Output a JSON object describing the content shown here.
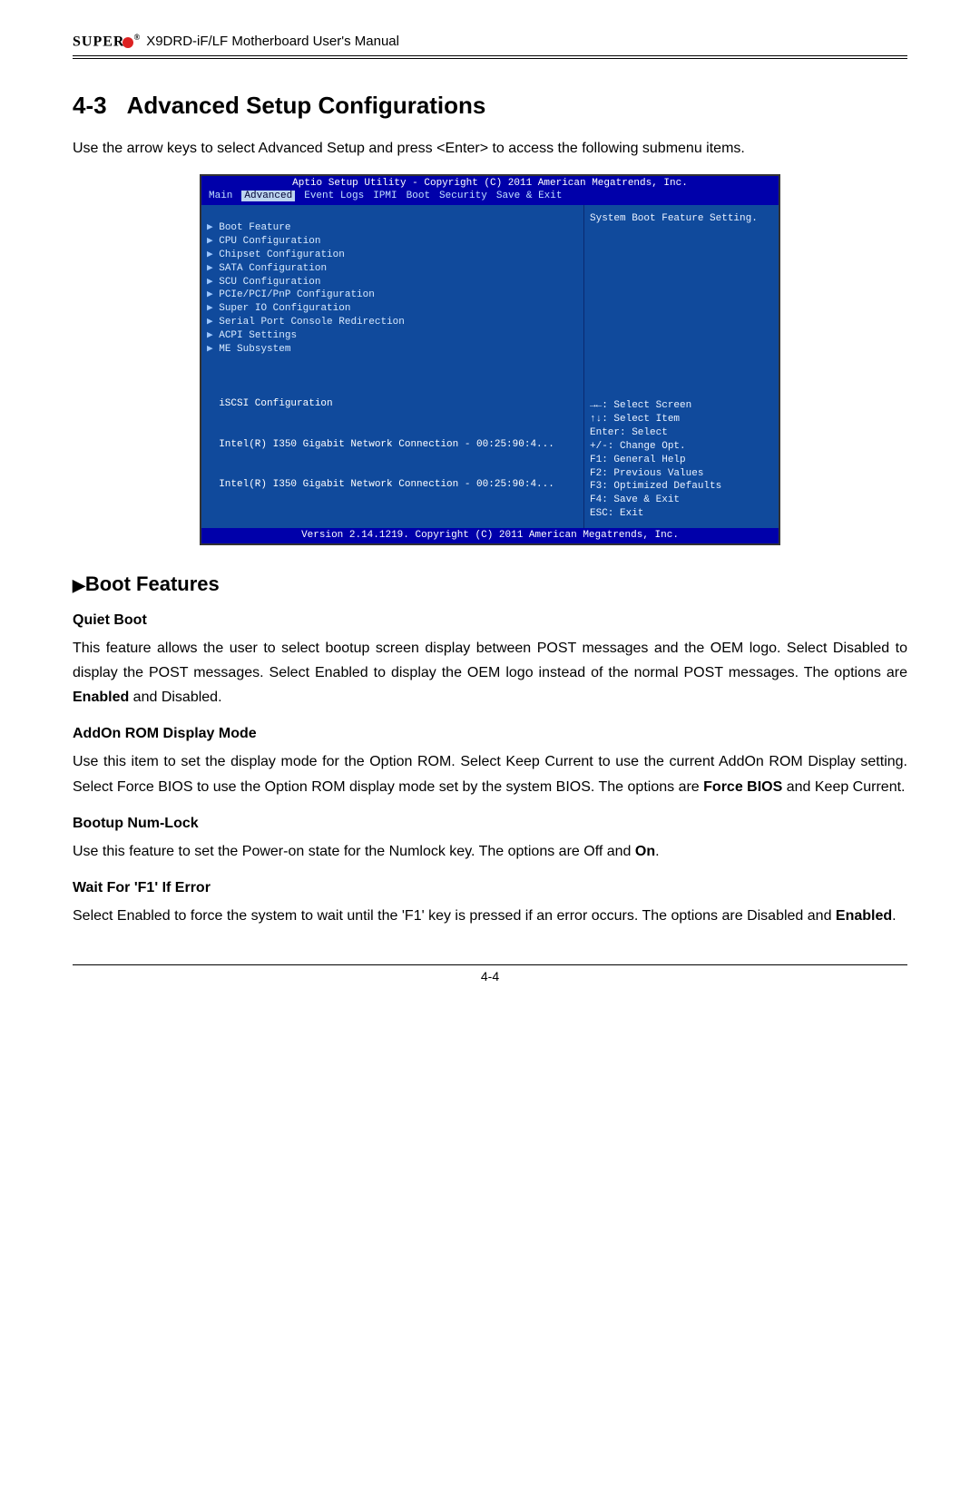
{
  "header": {
    "brand": "SUPER",
    "regmark": "®",
    "title": "X9DRD-iF/LF Motherboard User's Manual"
  },
  "section": {
    "number": "4-3",
    "title": "Advanced Setup Configurations",
    "intro": "Use the arrow keys to select Advanced Setup and press <Enter> to access the following submenu items."
  },
  "bios": {
    "title": "Aptio Setup Utility - Copyright (C) 2011 American Megatrends, Inc.",
    "menu": [
      "Main",
      "Advanced",
      "Event Logs",
      "IPMI",
      "Boot",
      "Security",
      "Save & Exit"
    ],
    "selected_tab": "Advanced",
    "items": [
      "Boot Feature",
      "CPU Configuration",
      "Chipset Configuration",
      "SATA Configuration",
      "SCU Configuration",
      "PCIe/PCI/PnP Configuration",
      "Super IO Configuration",
      "Serial Port Console Redirection",
      "ACPI Settings",
      "ME Subsystem"
    ],
    "secondary": [
      "iSCSI Configuration",
      "Intel(R) I350 Gigabit Network Connection - 00:25:90:4...",
      "Intel(R) I350 Gigabit Network Connection - 00:25:90:4..."
    ],
    "right_help": "System Boot Feature Setting.",
    "right_keys": "→←: Select Screen\n↑↓: Select Item\nEnter: Select\n+/-: Change Opt.\nF1: General Help\nF2: Previous Values\nF3: Optimized Defaults\nF4: Save & Exit\nESC: Exit",
    "footer": "Version 2.14.1219. Copyright (C) 2011 American Megatrends, Inc."
  },
  "subsection": {
    "title": "Boot Features"
  },
  "features": {
    "f1": {
      "h": "Quiet Boot",
      "p_a": "This feature allows the user to select bootup screen display between POST messages and the OEM logo. Select Disabled to display the POST messages. Select Enabled to display the OEM logo instead of the normal POST messages. The options are ",
      "p_b": "Enabled",
      "p_c": " and Disabled."
    },
    "f2": {
      "h": "AddOn ROM Display Mode",
      "p_a": "Use this item to set the display mode for the Option ROM. Select Keep Current to use the current AddOn ROM Display setting. Select Force BIOS to use the Option ROM display mode set by the system BIOS. The options are ",
      "p_b": "Force BIOS",
      "p_c": " and Keep Current."
    },
    "f3": {
      "h": "Bootup Num-Lock",
      "p_a": "Use this feature to set the Power-on state for the Numlock key. The options are Off and ",
      "p_b": "On",
      "p_c": "."
    },
    "f4": {
      "h": "Wait For 'F1' If Error",
      "p_a": "Select Enabled to force the system to wait until the 'F1' key is pressed if an error occurs. The options are Disabled and ",
      "p_b": "Enabled",
      "p_c": "."
    }
  },
  "pagenum": "4-4"
}
